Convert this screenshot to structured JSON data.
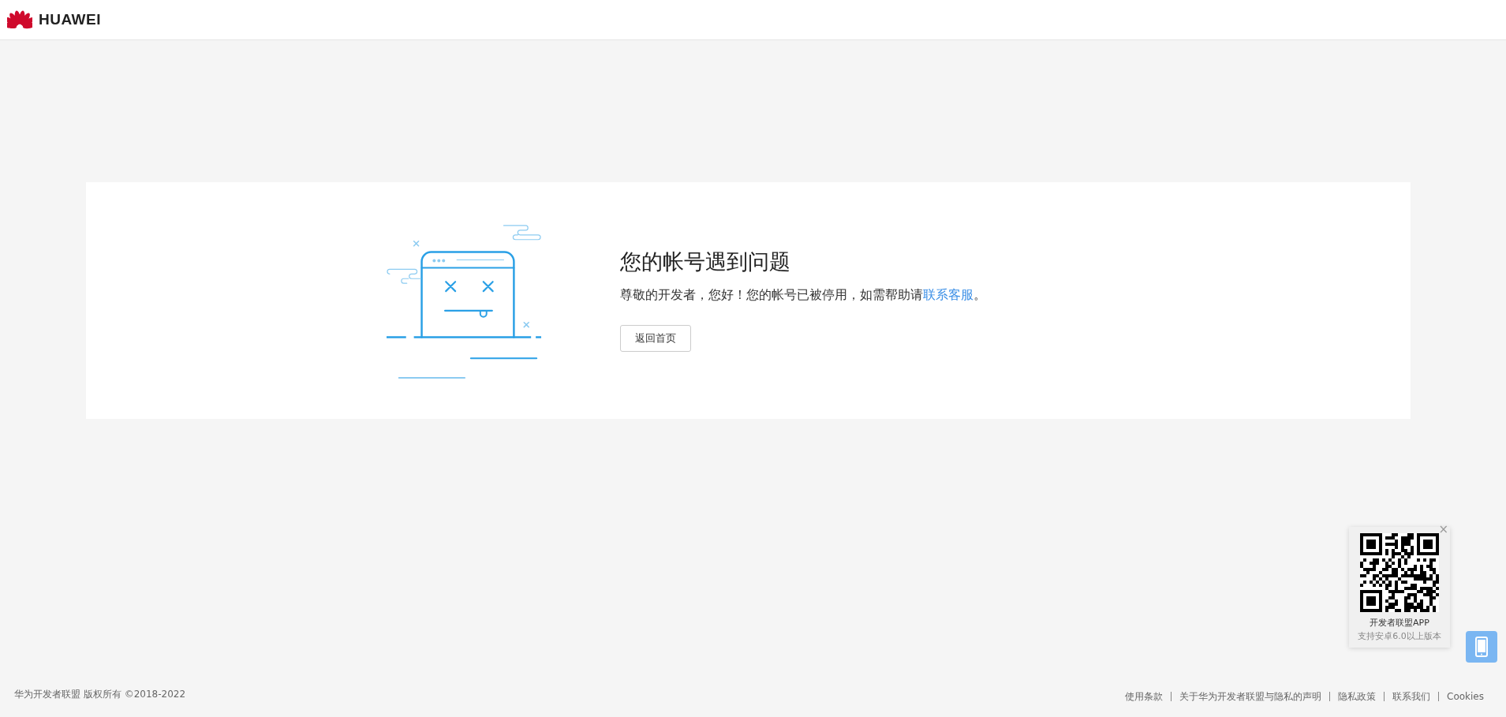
{
  "header": {
    "brand": "HUAWEI"
  },
  "error": {
    "title": "您的帐号遇到问题",
    "message_before": "尊敬的开发者，您好！您的帐号已被停用，如需帮助请",
    "message_link": "联系客服",
    "message_after": "。",
    "button": "返回首页"
  },
  "app_popup": {
    "title": "开发者联盟APP",
    "subtitle": "支持安卓6.0以上版本",
    "close": "×"
  },
  "footer": {
    "copyright": "华为开发者联盟 版权所有 ©2018-2022",
    "links": [
      "使用条款",
      "关于华为开发者联盟与隐私的声明",
      "隐私政策",
      "联系我们",
      "Cookies"
    ]
  }
}
